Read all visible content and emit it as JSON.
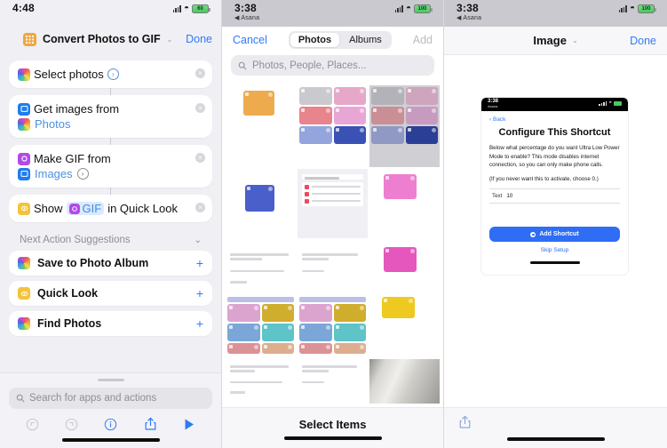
{
  "screen1": {
    "status": {
      "time": "4:48",
      "back_app": "",
      "battery": ""
    },
    "nav": {
      "title": "Convert Photos to GIF",
      "chevron": "⌄",
      "done_label": "Done"
    },
    "actions": [
      {
        "icon": "photos-icon",
        "text": "Select photos",
        "has_arrow": true,
        "line2": null,
        "close": "×"
      },
      {
        "icon": "photos-app-icon",
        "text": "Get images from",
        "has_arrow": false,
        "line2": {
          "icon": "photos-icon",
          "token": "Photos",
          "arrow": false
        },
        "close": "×"
      },
      {
        "icon": "gif-icon",
        "text": "Make GIF from",
        "has_arrow": false,
        "line2": {
          "icon": "images-icon",
          "token": "Images",
          "arrow": true
        },
        "close": "×"
      },
      {
        "icon": "quicklook-icon",
        "text_before": "Show",
        "token": "GIF",
        "text_after": "in Quick Look",
        "close": "×"
      }
    ],
    "suggestions": {
      "header": "Next Action Suggestions",
      "chevron": "⌄",
      "items": [
        {
          "icon": "photos-icon",
          "label": "Save to Photo Album",
          "plus": "+"
        },
        {
          "icon": "quicklook-icon",
          "label": "Quick Look",
          "plus": "+"
        },
        {
          "icon": "photos-icon",
          "label": "Find Photos",
          "plus": "+"
        }
      ]
    },
    "search": {
      "placeholder": "Search for apps and actions",
      "icon": "search-icon"
    },
    "toolbar": [
      {
        "name": "undo-icon",
        "glyph": "↺",
        "enabled": false
      },
      {
        "name": "redo-icon",
        "glyph": "↻",
        "enabled": false
      },
      {
        "name": "info-icon",
        "glyph": "i",
        "enabled": true
      },
      {
        "name": "share-icon",
        "glyph": "share",
        "enabled": true
      },
      {
        "name": "play-icon",
        "glyph": "▶",
        "enabled": true
      }
    ]
  },
  "screen2": {
    "status": {
      "time": "3:38",
      "back_app": "◀ Asana"
    },
    "nav": {
      "cancel_label": "Cancel",
      "add_label": "Add",
      "segments": [
        {
          "label": "Photos",
          "selected": true
        },
        {
          "label": "Albums",
          "selected": false
        }
      ]
    },
    "search": {
      "placeholder": "Photos, People, Places...",
      "icon": "search-icon"
    },
    "bottom": {
      "label": "Select Items"
    },
    "grid": {
      "row1": [
        "shortcut-grid-orange",
        "shortcut-list-pink",
        "shortcut-grid-gray"
      ],
      "row2": [
        "shortcut-blue-tile",
        "next-action-suggestions-shot",
        "pink-card"
      ],
      "row3": [
        "text-shot-a",
        "text-shot-b",
        "pink-card-2"
      ],
      "row4": [
        "shortcut-grid-colorful",
        "shortcut-grid-colorful-2",
        "yellow-card"
      ],
      "row5": [
        "text-shot-c",
        "text-shot-d",
        "paper-photo"
      ]
    }
  },
  "screen3": {
    "status": {
      "time": "3:38",
      "back_app": "◀ Asana"
    },
    "nav": {
      "title": "Image",
      "chevron": "⌄",
      "done_label": "Done"
    },
    "preview": {
      "inner_status": {
        "time": "3:38",
        "back_app": "Asana"
      },
      "back_label": "Back",
      "heading": "Configure This Shortcut",
      "paragraph1": "Below what percentage do you want Ultra Low Power Mode to enable? This mode disables internet connection, so you can only make phone calls.",
      "paragraph2": "(If you never want this to activate, choose 0.)",
      "field": {
        "key": "Text",
        "value": "10"
      },
      "primary_button": "Add Shortcut",
      "secondary_link": "Skip Setup"
    },
    "bottom": {
      "share_icon": "share-icon"
    }
  },
  "colors": {
    "accent_blue": "#2f7bf6",
    "button_blue": "#2f6df5",
    "orange_icon": "#f0a73e",
    "purple_icon": "#b14ae8",
    "yellow_icon": "#f2c33c",
    "token_bg": "#dbeafe"
  }
}
